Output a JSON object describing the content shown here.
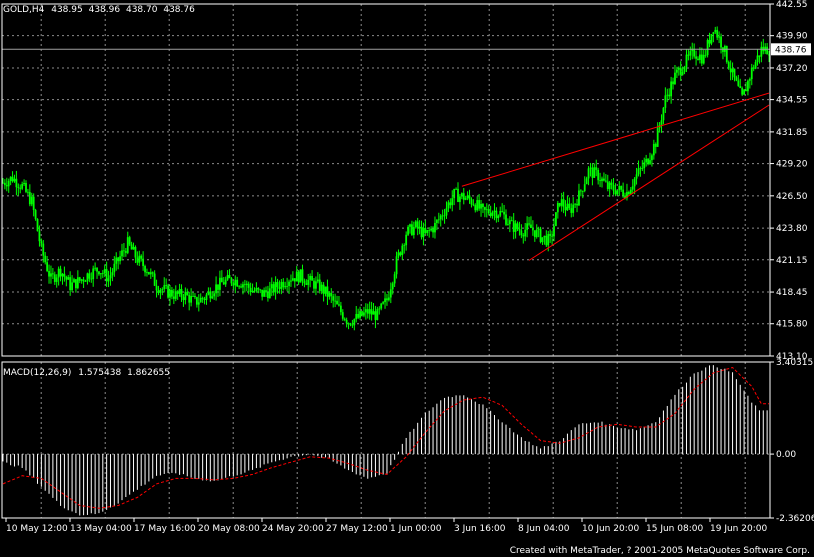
{
  "price_header": {
    "symbol": "GOLD,H4",
    "open": "438.95",
    "high": "438.96",
    "low": "438.70",
    "close": "438.76"
  },
  "macd_header": {
    "name": "MACD(12,26,9)",
    "macd": "1.575438",
    "signal": "1.862655"
  },
  "footer": {
    "credit": "Created with MetaTrader, ? 2001-2005 MetaQuotes Software Corp."
  },
  "colors": {
    "background": "#000000",
    "grid": "#8c8c8c",
    "candle": "#00ff00",
    "histogram": "#ffffff",
    "signal": "#ff0000",
    "trendline": "#ff0000",
    "price_line": "#a0a0a0",
    "text": "#ffffff"
  },
  "chart_data": [
    {
      "type": "candlestick",
      "title": "GOLD,H4",
      "ylim": [
        413.1,
        442.55
      ],
      "y_ticks": [
        "442.55",
        "439.90",
        "437.20",
        "434.55",
        "431.85",
        "429.20",
        "426.50",
        "423.80",
        "421.15",
        "418.45",
        "415.80",
        "413.10"
      ],
      "last_price": "438.76",
      "close_path": [
        [
          0,
          427.6
        ],
        [
          5,
          428.0
        ],
        [
          10,
          427.3
        ],
        [
          15,
          426.0
        ],
        [
          20,
          422.0
        ],
        [
          25,
          419.5
        ],
        [
          30,
          420.3
        ],
        [
          35,
          419.0
        ],
        [
          40,
          419.4
        ],
        [
          45,
          420.0
        ],
        [
          50,
          420.4
        ],
        [
          55,
          419.6
        ],
        [
          60,
          421.1
        ],
        [
          65,
          422.5
        ],
        [
          70,
          421.2
        ],
        [
          75,
          420.4
        ],
        [
          80,
          419.0
        ],
        [
          85,
          418.5
        ],
        [
          90,
          418.2
        ],
        [
          95,
          418.2
        ],
        [
          100,
          417.6
        ],
        [
          105,
          418.0
        ],
        [
          110,
          418.8
        ],
        [
          115,
          419.3
        ],
        [
          120,
          419.5
        ],
        [
          125,
          419.2
        ],
        [
          130,
          418.6
        ],
        [
          135,
          418.3
        ],
        [
          140,
          418.6
        ],
        [
          145,
          419.2
        ],
        [
          150,
          419.7
        ],
        [
          155,
          419.8
        ],
        [
          160,
          419.3
        ],
        [
          165,
          418.9
        ],
        [
          170,
          418.1
        ],
        [
          175,
          417.0
        ],
        [
          180,
          416.0
        ],
        [
          185,
          416.3
        ],
        [
          190,
          416.8
        ],
        [
          195,
          416.5
        ],
        [
          200,
          417.8
        ],
        [
          205,
          421.0
        ],
        [
          210,
          423.4
        ],
        [
          215,
          423.9
        ],
        [
          220,
          423.2
        ],
        [
          225,
          424.0
        ],
        [
          230,
          425.3
        ],
        [
          235,
          426.6
        ],
        [
          240,
          426.4
        ],
        [
          245,
          426.0
        ],
        [
          250,
          425.1
        ],
        [
          255,
          425.3
        ],
        [
          260,
          425.0
        ],
        [
          265,
          424.0
        ],
        [
          270,
          423.6
        ],
        [
          275,
          423.8
        ],
        [
          280,
          423.1
        ],
        [
          285,
          422.7
        ],
        [
          290,
          426.1
        ],
        [
          295,
          425.2
        ],
        [
          300,
          426.5
        ],
        [
          305,
          428.6
        ],
        [
          310,
          428.2
        ],
        [
          315,
          427.2
        ],
        [
          320,
          427.0
        ],
        [
          325,
          426.8
        ],
        [
          330,
          428.2
        ],
        [
          335,
          429.3
        ],
        [
          340,
          431.0
        ],
        [
          345,
          434.6
        ],
        [
          350,
          436.5
        ],
        [
          355,
          437.6
        ],
        [
          360,
          438.5
        ],
        [
          365,
          438.0
        ],
        [
          370,
          440.7
        ],
        [
          375,
          439.0
        ],
        [
          380,
          436.6
        ],
        [
          385,
          434.6
        ],
        [
          390,
          437.0
        ],
        [
          395,
          438.76
        ]
      ],
      "trendlines": [
        {
          "from": [
            239,
            427.3
          ],
          "to": [
            399,
            435.1
          ]
        },
        {
          "from": [
            274,
            421.1
          ],
          "to": [
            399,
            434.1
          ]
        }
      ]
    },
    {
      "type": "bar",
      "title": "MACD(12,26,9)",
      "ylim": [
        -2.36206,
        3.40315
      ],
      "y_ticks": [
        "3.40315",
        "0.00",
        "-2.36206"
      ],
      "series": [
        {
          "name": "MACD",
          "points": [
            [
              0,
              -0.3
            ],
            [
              10,
              -0.5
            ],
            [
              20,
              -1.2
            ],
            [
              30,
              -1.9
            ],
            [
              40,
              -2.25
            ],
            [
              50,
              -2.2
            ],
            [
              60,
              -1.8
            ],
            [
              70,
              -1.3
            ],
            [
              80,
              -0.8
            ],
            [
              90,
              -0.7
            ],
            [
              100,
              -0.9
            ],
            [
              110,
              -1.0
            ],
            [
              120,
              -0.8
            ],
            [
              130,
              -0.6
            ],
            [
              140,
              -0.3
            ],
            [
              150,
              -0.1
            ],
            [
              160,
              0.0
            ],
            [
              170,
              -0.2
            ],
            [
              180,
              -0.6
            ],
            [
              190,
              -0.9
            ],
            [
              200,
              -0.7
            ],
            [
              210,
              0.6
            ],
            [
              220,
              1.5
            ],
            [
              230,
              2.1
            ],
            [
              240,
              2.2
            ],
            [
              250,
              1.8
            ],
            [
              260,
              1.2
            ],
            [
              270,
              0.6
            ],
            [
              280,
              0.2
            ],
            [
              290,
              0.5
            ],
            [
              300,
              1.1
            ],
            [
              310,
              1.2
            ],
            [
              320,
              1.0
            ],
            [
              330,
              0.9
            ],
            [
              340,
              1.2
            ],
            [
              350,
              2.2
            ],
            [
              360,
              3.0
            ],
            [
              370,
              3.3
            ],
            [
              380,
              3.0
            ],
            [
              390,
              1.9
            ],
            [
              395,
              1.58
            ]
          ]
        },
        {
          "name": "Signal",
          "points": [
            [
              0,
              -1.1
            ],
            [
              10,
              -0.8
            ],
            [
              20,
              -0.9
            ],
            [
              30,
              -1.4
            ],
            [
              40,
              -1.9
            ],
            [
              50,
              -2.0
            ],
            [
              60,
              -1.9
            ],
            [
              70,
              -1.6
            ],
            [
              80,
              -1.1
            ],
            [
              90,
              -0.9
            ],
            [
              100,
              -0.9
            ],
            [
              110,
              -0.95
            ],
            [
              120,
              -0.9
            ],
            [
              130,
              -0.75
            ],
            [
              140,
              -0.5
            ],
            [
              150,
              -0.3
            ],
            [
              160,
              -0.1
            ],
            [
              170,
              -0.15
            ],
            [
              180,
              -0.35
            ],
            [
              190,
              -0.6
            ],
            [
              200,
              -0.75
            ],
            [
              210,
              -0.1
            ],
            [
              220,
              0.8
            ],
            [
              230,
              1.6
            ],
            [
              240,
              2.0
            ],
            [
              250,
              2.1
            ],
            [
              260,
              1.8
            ],
            [
              270,
              1.1
            ],
            [
              280,
              0.5
            ],
            [
              290,
              0.4
            ],
            [
              300,
              0.6
            ],
            [
              310,
              1.0
            ],
            [
              320,
              1.1
            ],
            [
              330,
              1.0
            ],
            [
              340,
              1.0
            ],
            [
              350,
              1.5
            ],
            [
              360,
              2.4
            ],
            [
              370,
              3.0
            ],
            [
              380,
              3.2
            ],
            [
              390,
              2.5
            ],
            [
              395,
              1.86
            ]
          ]
        }
      ]
    }
  ],
  "x_axis_labels": [
    "10 May 12:00",
    "13 May 04:00",
    "17 May 16:00",
    "20 May 08:00",
    "24 May 20:00",
    "27 May 12:00",
    "1 Jun 00:00",
    "3 Jun 16:00",
    "8 Jun 04:00",
    "10 Jun 20:00",
    "15 Jun 08:00",
    "19 Jun 20:00"
  ]
}
